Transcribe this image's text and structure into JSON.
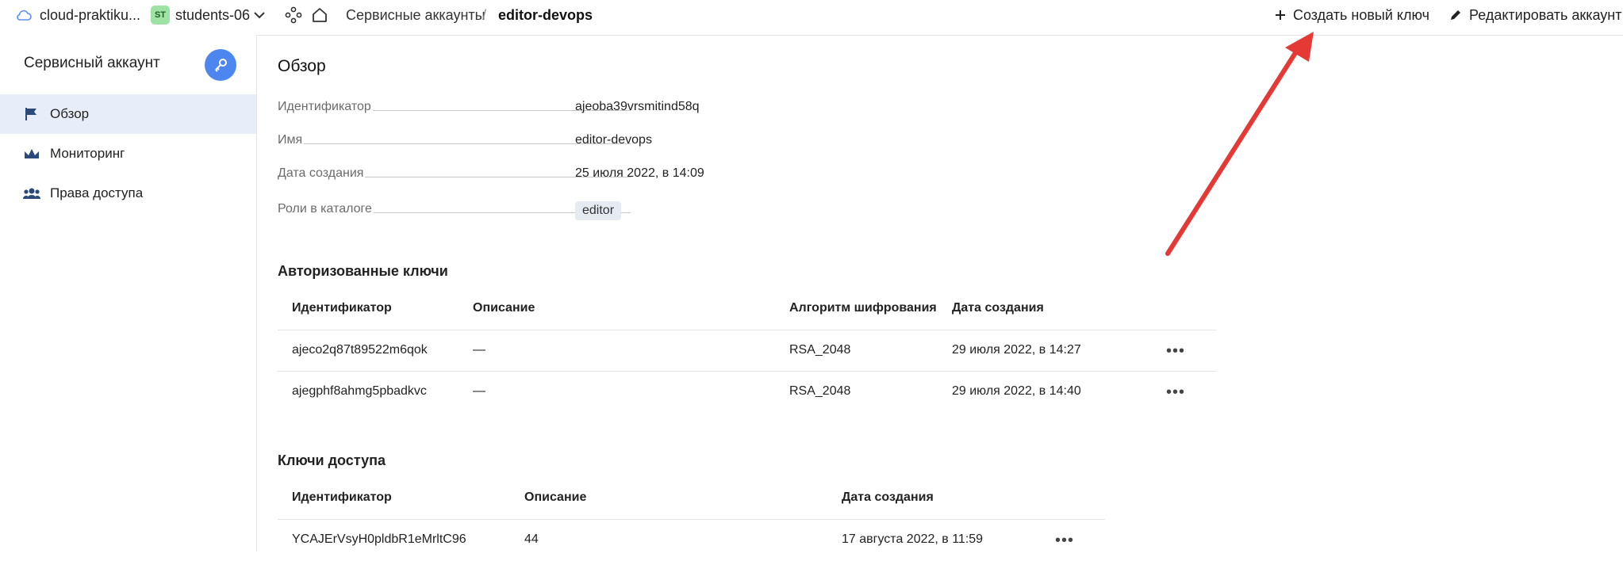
{
  "topbar": {
    "cloud_label": "cloud-praktiku...",
    "folder_badge": "ST",
    "folder_label": "students-06",
    "breadcrumb_service_accounts": "Сервисные аккаунты",
    "breadcrumb_separator": "/",
    "breadcrumb_current": "editor-devops",
    "create_key_label": "Создать новый ключ",
    "edit_account_label": "Редактировать аккаунт"
  },
  "sidebar": {
    "title": "Сервисный аккаунт",
    "items": [
      {
        "label": "Обзор",
        "icon": "flag-icon",
        "active": true
      },
      {
        "label": "Мониторинг",
        "icon": "chart-icon",
        "active": false
      },
      {
        "label": "Права доступа",
        "icon": "users-icon",
        "active": false
      }
    ]
  },
  "overview": {
    "title": "Обзор",
    "properties": [
      {
        "key": "Идентификатор",
        "value": "ajeoba39vrsmitind58q"
      },
      {
        "key": "Имя",
        "value": "editor-devops"
      },
      {
        "key": "Дата создания",
        "value": "25 июля 2022, в 14:09"
      },
      {
        "key": "Роли в каталоге",
        "value": "editor"
      }
    ]
  },
  "authorized_keys": {
    "title": "Авторизованные ключи",
    "columns": [
      "Идентификатор",
      "Описание",
      "Алгоритм шифрования",
      "Дата создания"
    ],
    "rows": [
      {
        "id": "ajeco2q87t89522m6qok",
        "description": "—",
        "algorithm": "RSA_2048",
        "created": "29 июля 2022, в 14:27"
      },
      {
        "id": "ajegphf8ahmg5pbadkvc",
        "description": "—",
        "algorithm": "RSA_2048",
        "created": "29 июля 2022, в 14:40"
      }
    ]
  },
  "access_keys": {
    "title": "Ключи доступа",
    "columns": [
      "Идентификатор",
      "Описание",
      "Дата создания"
    ],
    "rows": [
      {
        "id": "YCAJErVsyH0pldbR1eMrltC96",
        "description": "44",
        "created": "17 августа 2022, в 11:59"
      }
    ]
  },
  "more_glyph": "•••",
  "colors": {
    "accent": "#4d86ee",
    "active_bg": "#e8eef9",
    "arrow": "#e53935",
    "badge_bg": "#9ee2a4"
  }
}
